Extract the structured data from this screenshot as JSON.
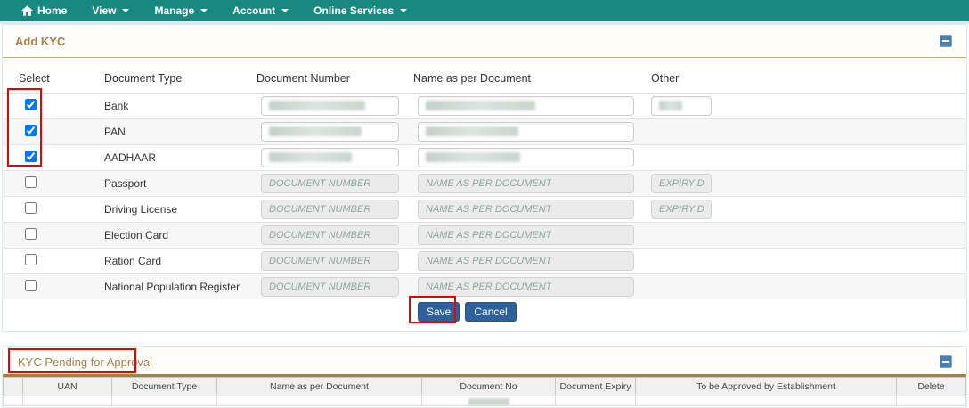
{
  "navbar": {
    "items": [
      {
        "label": "Home",
        "icon": "home",
        "dropdown": false
      },
      {
        "label": "View",
        "dropdown": true
      },
      {
        "label": "Manage",
        "dropdown": true
      },
      {
        "label": "Account",
        "dropdown": true
      },
      {
        "label": "Online Services",
        "dropdown": true
      }
    ]
  },
  "add_kyc": {
    "title": "Add KYC",
    "collapse_icon": "minus",
    "table": {
      "headers": [
        "Select",
        "Document Type",
        "Document Number",
        "Name as per Document",
        "Other"
      ],
      "placeholders": {
        "document_number": "DOCUMENT NUMBER",
        "name_as_per_document": "NAME AS PER DOCUMENT",
        "expiry": "EXPIRY DT"
      },
      "rows": [
        {
          "document_type": "Bank",
          "checked": true,
          "document_number": {
            "state": "filled",
            "masked_width": 108
          },
          "name_as_per_document": {
            "state": "filled",
            "masked_width": 123
          },
          "other": {
            "state": "filled",
            "masked_width": 26,
            "small": true
          }
        },
        {
          "document_type": "PAN",
          "checked": true,
          "document_number": {
            "state": "filled",
            "masked_width": 104
          },
          "name_as_per_document": {
            "state": "filled",
            "masked_width": 104
          },
          "other": null
        },
        {
          "document_type": "AADHAAR",
          "checked": true,
          "document_number": {
            "state": "filled",
            "masked_width": 93
          },
          "name_as_per_document": {
            "state": "filled",
            "masked_width": 106
          },
          "other": null
        },
        {
          "document_type": "Passport",
          "checked": false,
          "document_number": {
            "state": "placeholder"
          },
          "name_as_per_document": {
            "state": "placeholder"
          },
          "other": {
            "state": "placeholder",
            "placeholder_key": "expiry",
            "small": true
          }
        },
        {
          "document_type": "Driving License",
          "checked": false,
          "document_number": {
            "state": "placeholder"
          },
          "name_as_per_document": {
            "state": "placeholder"
          },
          "other": {
            "state": "placeholder",
            "placeholder_key": "expiry",
            "small": true
          }
        },
        {
          "document_type": "Election Card",
          "checked": false,
          "document_number": {
            "state": "placeholder"
          },
          "name_as_per_document": {
            "state": "placeholder"
          },
          "other": null
        },
        {
          "document_type": "Ration Card",
          "checked": false,
          "document_number": {
            "state": "placeholder"
          },
          "name_as_per_document": {
            "state": "placeholder"
          },
          "other": null
        },
        {
          "document_type": "National Population Register",
          "checked": false,
          "document_number": {
            "state": "placeholder"
          },
          "name_as_per_document": {
            "state": "placeholder"
          },
          "other": null
        }
      ]
    },
    "buttons": {
      "save": "Save",
      "cancel": "Cancel"
    }
  },
  "pending": {
    "title": "KYC Pending for Approval",
    "collapse_icon": "minus",
    "headers": [
      "",
      "UAN",
      "Document Type",
      "Name as per Document",
      "Document No",
      "Document Expiry",
      "To be Approved by Establishment",
      "Delete"
    ]
  },
  "colors": {
    "navbar": "#17897e",
    "panel_title": "#a5804e",
    "heading_rule": "#c6ad72",
    "button_blue": "#2e6199",
    "collapse_button": "#4a80b1",
    "annotation_red": "#e60000",
    "placeholder_text": "#8da69c"
  }
}
